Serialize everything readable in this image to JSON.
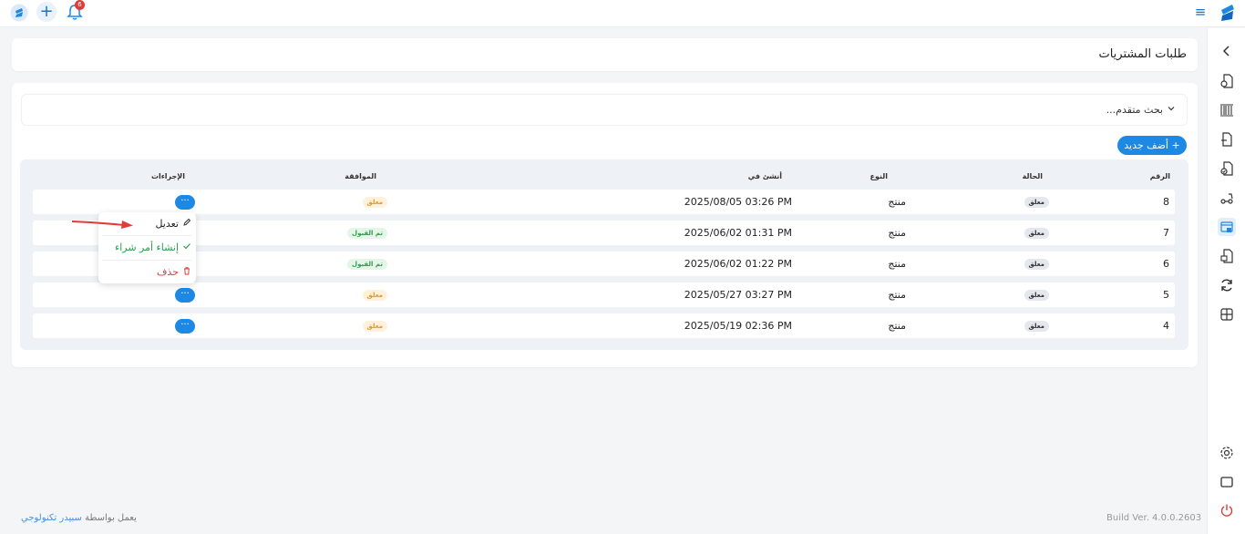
{
  "topbar": {
    "notification_count": "6",
    "icons": [
      "app-logo-icon",
      "plus-icon",
      "bell-icon",
      "menu-icon"
    ]
  },
  "page": {
    "title": "طلبات المشتريات"
  },
  "search": {
    "label": "بحث متقدم..."
  },
  "actions": {
    "add_new": "أضف جديد"
  },
  "table": {
    "headers": {
      "number": "الرقم",
      "status": "الحالة",
      "type": "النوع",
      "created_at": "أنشئ في",
      "approval": "الموافقة",
      "actions": "الإجراءات"
    },
    "rows": [
      {
        "number": "8",
        "status": "معلق",
        "type": "منتج",
        "created_at": "2025/08/05 03:26 PM",
        "approval": "معلق",
        "approval_state": "pending"
      },
      {
        "number": "7",
        "status": "معلق",
        "type": "منتج",
        "created_at": "2025/06/02 01:31 PM",
        "approval": "تم القبول",
        "approval_state": "accepted"
      },
      {
        "number": "6",
        "status": "معلق",
        "type": "منتج",
        "created_at": "2025/06/02 01:22 PM",
        "approval": "تم القبول",
        "approval_state": "accepted"
      },
      {
        "number": "5",
        "status": "معلق",
        "type": "منتج",
        "created_at": "2025/05/27 03:27 PM",
        "approval": "معلق",
        "approval_state": "pending"
      },
      {
        "number": "4",
        "status": "معلق",
        "type": "منتج",
        "created_at": "2025/05/19 02:36 PM",
        "approval": "معلق",
        "approval_state": "pending"
      }
    ],
    "row_action_label": "···"
  },
  "dropdown": {
    "edit": "تعديل",
    "create_po": "إنشاء أمر شراء",
    "delete": "حذف"
  },
  "footer": {
    "powered_by": "يعمل بواسطة",
    "brand": "سبيدر تكنولوجي",
    "build": "Build Ver. 4.0.0.2603"
  },
  "colors": {
    "primary": "#1e88e5",
    "danger": "#e53935",
    "success": "#2e9e4f",
    "warning": "#e09a2c"
  }
}
